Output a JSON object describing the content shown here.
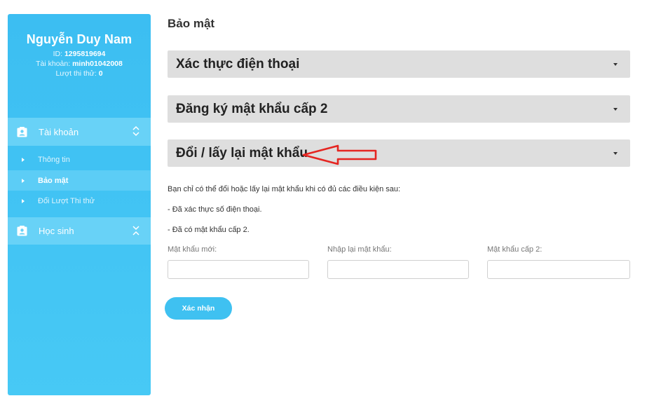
{
  "profile": {
    "name": "Nguyễn Duy Nam",
    "id_label": "ID:",
    "id_value": "1295819694",
    "account_label": "Tài khoản:",
    "account_value": "minh01042008",
    "attempts_label": "Lượt thi thử:",
    "attempts_value": "0"
  },
  "sidebar": {
    "sections": [
      {
        "label": "Tài khoản",
        "icon": "contact-card-icon",
        "state": "expanded"
      },
      {
        "label": "Học sinh",
        "icon": "contact-card-icon",
        "state": "collapsed"
      }
    ],
    "account_items": [
      {
        "label": "Thông tin",
        "active": false
      },
      {
        "label": "Bảo mật",
        "active": true
      },
      {
        "label": "Đổi Lượt Thi thử",
        "active": false
      }
    ]
  },
  "main": {
    "title": "Bảo mật",
    "accordions": [
      {
        "label": "Xác thực điện thoại"
      },
      {
        "label": "Đăng ký mật khẩu cấp 2"
      },
      {
        "label": "Đổi / lấy lại mật khẩu"
      }
    ],
    "notes": [
      "Bạn chỉ có thể đổi hoặc lấy lại mật khẩu khi có đủ các điều kiện sau:",
      "- Đã xác thực số điện thoại.",
      "- Đã có mật khẩu cấp 2."
    ],
    "fields": [
      {
        "label": "Mật khẩu mới:",
        "value": ""
      },
      {
        "label": "Nhập lại mật khẩu:",
        "value": ""
      },
      {
        "label": "Mật khẩu cấp 2:",
        "value": ""
      }
    ],
    "submit_label": "Xác nhận"
  },
  "colors": {
    "sidebar": "#3cbef2",
    "sidebar_section": "#68d2f7",
    "accordion": "#dedede",
    "button": "#3fc1f1",
    "annotation_arrow": "#e52521"
  }
}
